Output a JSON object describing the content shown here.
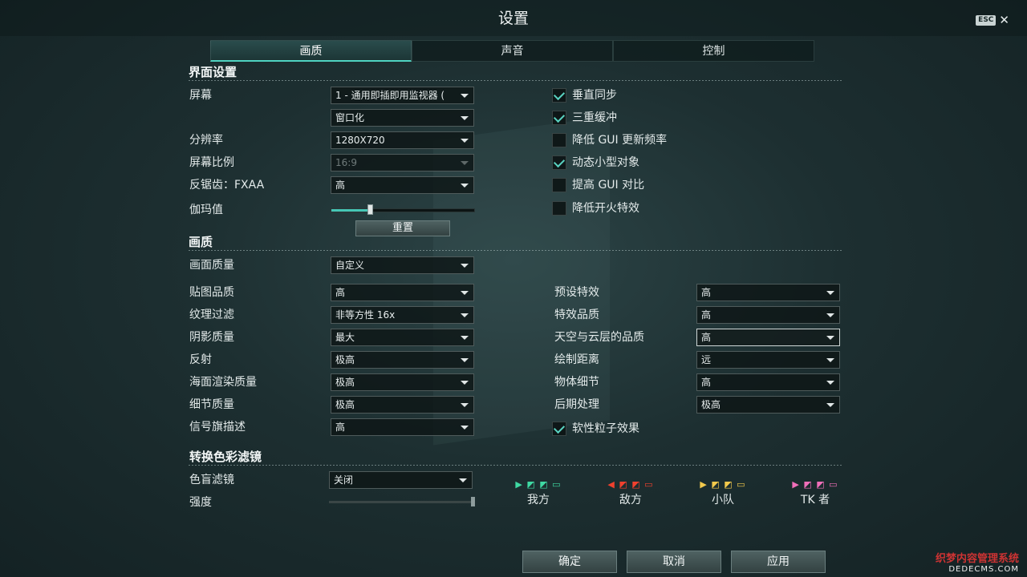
{
  "window": {
    "title": "设置",
    "esc_label": "ESC",
    "close_glyph": "✕"
  },
  "tabs": [
    {
      "label": "画质",
      "active": true
    },
    {
      "label": "声音",
      "active": false
    },
    {
      "label": "控制",
      "active": false
    }
  ],
  "interface": {
    "heading": "界面设置",
    "screen": {
      "label": "屏幕",
      "value": "1 - 通用即插即用监视器 ("
    },
    "window_mode": {
      "value": "窗口化"
    },
    "resolution": {
      "label": "分辨率",
      "value": "1280X720"
    },
    "aspect_ratio": {
      "label": "屏幕比例",
      "value": "16:9",
      "disabled": true
    },
    "antialiasing": {
      "label": "反锯齿：FXAA",
      "value": "高"
    },
    "gamma": {
      "label": "伽玛值",
      "level": 0.27
    },
    "reset_button": "重置",
    "checkboxes": [
      {
        "label": "垂直同步",
        "checked": true
      },
      {
        "label": "三重缓冲",
        "checked": true
      },
      {
        "label": "降低 GUI 更新频率",
        "checked": false
      },
      {
        "label": "动态小型对象",
        "checked": true
      },
      {
        "label": "提高 GUI 对比",
        "checked": false
      },
      {
        "label": "降低开火特效",
        "checked": false
      }
    ]
  },
  "quality": {
    "heading": "画质",
    "preset": {
      "label": "画面质量",
      "value": "自定义"
    },
    "left": [
      {
        "label": "贴图品质",
        "value": "高"
      },
      {
        "label": "纹理过滤",
        "value": "非等方性 16x"
      },
      {
        "label": "阴影质量",
        "value": "最大"
      },
      {
        "label": "反射",
        "value": "极高"
      },
      {
        "label": "海面渲染质量",
        "value": "极高"
      },
      {
        "label": "细节质量",
        "value": "极高"
      },
      {
        "label": "信号旗描述",
        "value": "高"
      }
    ],
    "right": [
      {
        "label": "预设特效",
        "value": "高"
      },
      {
        "label": "特效品质",
        "value": "高"
      },
      {
        "label": "天空与云层的品质",
        "value": "高",
        "highlighted": true
      },
      {
        "label": "绘制距离",
        "value": "远"
      },
      {
        "label": "物体细节",
        "value": "高"
      },
      {
        "label": "后期处理",
        "value": "极高"
      }
    ],
    "soft_particles": {
      "label": "软性粒子效果",
      "checked": true
    }
  },
  "color_filter": {
    "heading": "转换色彩滤镜",
    "colorblind": {
      "label": "色盲滤镜",
      "value": "关闭"
    },
    "intensity": {
      "label": "强度",
      "level": 1.0
    },
    "teams": [
      {
        "name": "我方",
        "color": "#3fd9a3",
        "glyphs": "▶ ◩ ◩ ▭"
      },
      {
        "name": "敌方",
        "color": "#f0412e",
        "glyphs": "◀ ◩ ◩ ▭"
      },
      {
        "name": "小队",
        "color": "#f2c94c",
        "glyphs": "▶ ◩ ◩ ▭"
      },
      {
        "name": "TK 者",
        "color": "#f06fb9",
        "glyphs": "▶ ◩ ◩ ▭"
      }
    ]
  },
  "footer": {
    "ok": "确定",
    "cancel": "取消",
    "apply": "应用"
  },
  "watermark": {
    "line1": "织梦内容管理系统",
    "line2": "DEDECMS.COM"
  }
}
